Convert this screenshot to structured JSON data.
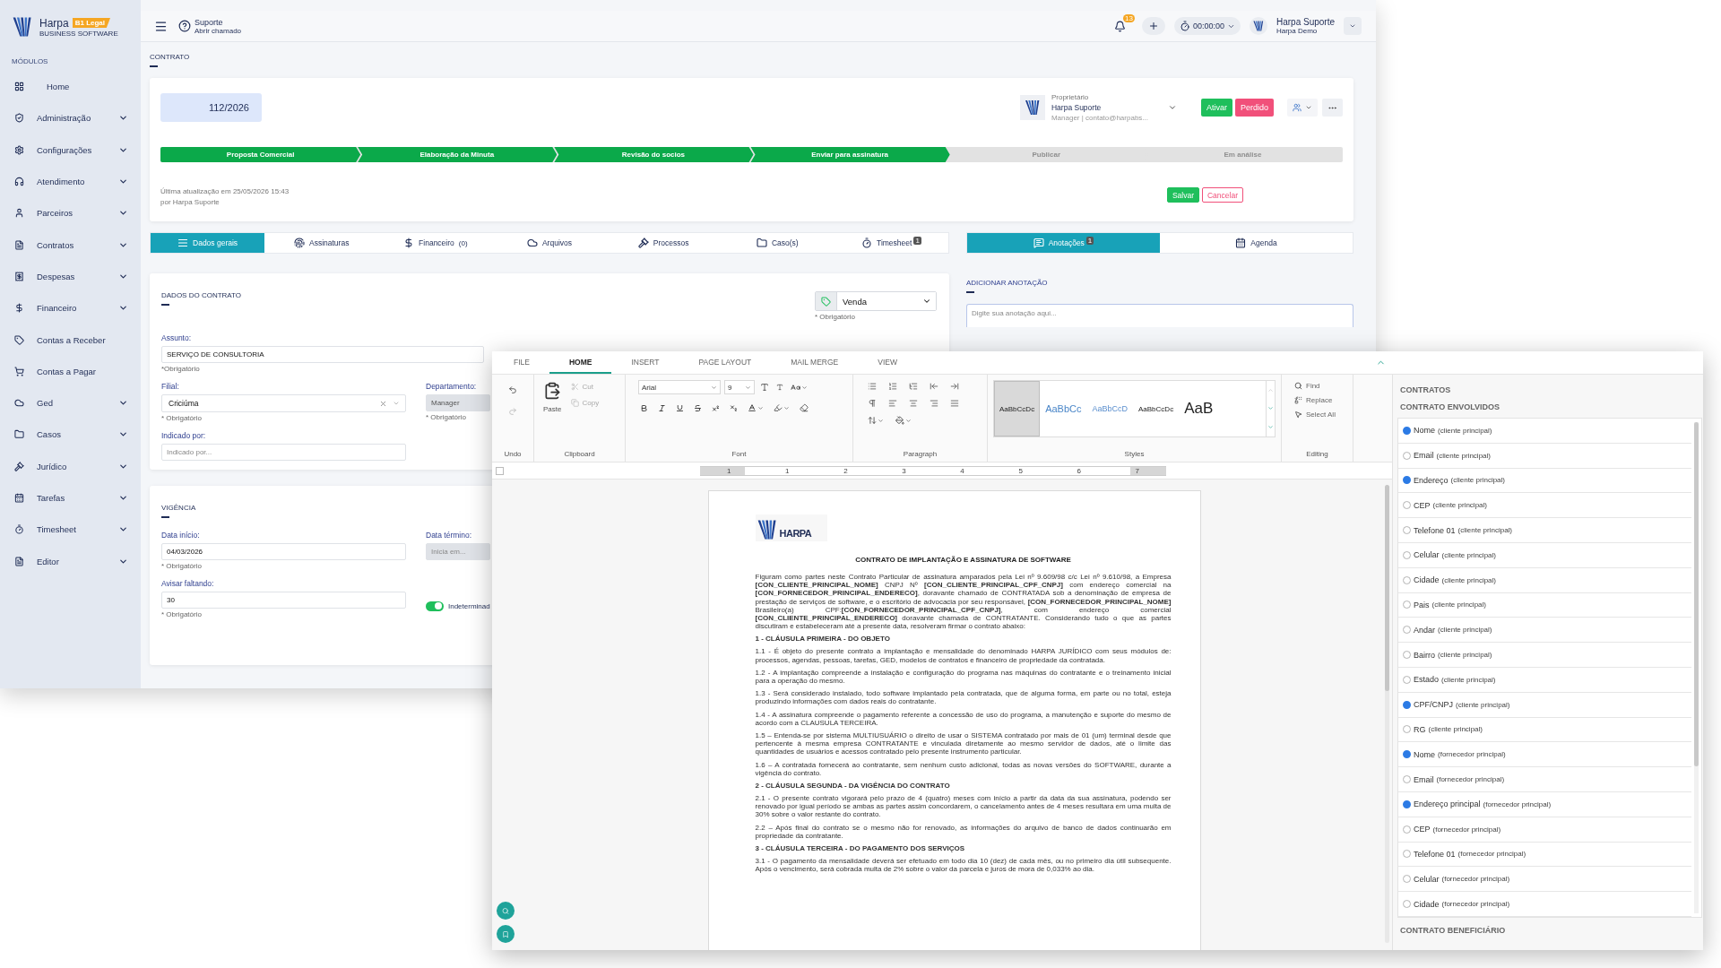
{
  "sidebar": {
    "brand": "Harpa",
    "badge": "B1 Legal",
    "tagline": "BUSINESS SOFTWARE",
    "section": "MÓDULOS",
    "items": [
      {
        "label": "Home",
        "kind": "grid",
        "expandable": false
      },
      {
        "label": "Administração",
        "kind": "shield",
        "expandable": true
      },
      {
        "label": "Configurações",
        "kind": "gear",
        "expandable": true
      },
      {
        "label": "Atendimento",
        "kind": "headset",
        "expandable": true
      },
      {
        "label": "Parceiros",
        "kind": "person",
        "expandable": true
      },
      {
        "label": "Contratos",
        "kind": "document",
        "expandable": true
      },
      {
        "label": "Despesas",
        "kind": "receipt",
        "expandable": true
      },
      {
        "label": "Financeiro",
        "kind": "dollar",
        "expandable": true
      },
      {
        "label": "Contas a Receber",
        "kind": "tag",
        "expandable": false
      },
      {
        "label": "Contas a Pagar",
        "kind": "cart",
        "expandable": false
      },
      {
        "label": "Ged",
        "kind": "cloud",
        "expandable": true
      },
      {
        "label": "Casos",
        "kind": "folder",
        "expandable": true
      },
      {
        "label": "Jurídico",
        "kind": "gavel",
        "expandable": true
      },
      {
        "label": "Tarefas",
        "kind": "calendar",
        "expandable": true
      },
      {
        "label": "Timesheet",
        "kind": "stopwatch",
        "expandable": true
      },
      {
        "label": "Editor",
        "kind": "document",
        "expandable": true
      }
    ]
  },
  "header": {
    "support_title": "Suporte",
    "support_sub": "Abrir chamado",
    "notifications": "13",
    "timer": "00:00:00",
    "user_name": "Harpa Suporte",
    "user_org": "Harpa Demo"
  },
  "page_title": "CONTRATO",
  "contract": {
    "number": "112/2026",
    "owner_label": "Proprietário",
    "owner_name": "Harpa Suporte",
    "owner_detail": "Manager | contato@harpabs...",
    "actions": [
      {
        "label": "Ativar",
        "kind": "success"
      },
      {
        "label": "Perdido",
        "kind": "danger"
      }
    ],
    "stages": [
      {
        "label": "Proposta Comercial",
        "done": true
      },
      {
        "label": "Elaboração da Minuta",
        "done": true
      },
      {
        "label": "Revisão do socios",
        "done": true
      },
      {
        "label": "Enviar para assinatura",
        "done": true
      },
      {
        "label": "Publicar",
        "done": false
      },
      {
        "label": "Em análise",
        "done": false
      }
    ],
    "updated": "Última atualização em 25/05/2026 15:43",
    "updated_by": "por Harpa Suporte",
    "save": "Salvar",
    "cancel": "Cancelar"
  },
  "tabs": [
    {
      "label": "Dados gerais",
      "kind": "lines",
      "selected": true
    },
    {
      "label": "Assinaturas",
      "kind": "fingerprint",
      "selected": false
    },
    {
      "label": "Financeiro",
      "kind": "dollar",
      "selected": false,
      "count": "(0)"
    },
    {
      "label": "Arquivos",
      "kind": "cloud",
      "selected": false
    },
    {
      "label": "Processos",
      "kind": "gavel",
      "selected": false
    },
    {
      "label": "Caso(s)",
      "kind": "folder",
      "selected": false
    },
    {
      "label": "Timesheet",
      "kind": "stopwatch",
      "selected": false,
      "badge": "1"
    }
  ],
  "side_tabs": [
    {
      "label": "Anotações",
      "kind": "chat",
      "selected": true,
      "badge": "1"
    },
    {
      "label": "Agenda",
      "kind": "calendar",
      "selected": false
    }
  ],
  "contract_data": {
    "title": "DADOS DO CONTRATO",
    "type_select": {
      "value": "Venda",
      "hint": "* Obrigatório"
    },
    "rows": [
      [
        {
          "label": "Assunto:",
          "kind": "wide",
          "value": "SERVIÇO DE CONSULTORIA",
          "hint": "*Obrigatório",
          "disabled": false
        }
      ],
      [
        {
          "label": "Filial:",
          "kind": "select",
          "value": "Criciúma",
          "hint": "* Obrigatório",
          "disabled": false
        },
        {
          "label": "Departamento:",
          "kind": "text",
          "value": "Manager",
          "hint": "* Obrigatório",
          "disabled": true
        }
      ],
      [
        {
          "label": "Indicado por:",
          "kind": "text",
          "placeholder": "Indicado por...",
          "disabled": false
        }
      ]
    ]
  },
  "validity": {
    "title": "VIGÊNCIA",
    "rows": [
      [
        {
          "label": "Data início:",
          "kind": "text",
          "value": "04/03/2026",
          "hint": "* Obrigatório",
          "disabled": false
        },
        {
          "label": "Data término:",
          "kind": "text",
          "placeholder": "Inicia em...",
          "disabled": true
        }
      ],
      [
        {
          "label": "Avisar faltando:",
          "kind": "text",
          "value": "30",
          "hint": "* Obrigatório",
          "disabled": false
        },
        {
          "label": "Indeterminad",
          "kind": "toggle",
          "on": true
        }
      ]
    ]
  },
  "annotations": {
    "title": "ADICIONAR ANOTAÇÃO",
    "placeholder": "Digite sua anotação aqui..."
  },
  "editor": {
    "tabs": [
      {
        "label": "FILE",
        "selected": false
      },
      {
        "label": "HOME",
        "selected": true
      },
      {
        "label": "INSERT",
        "selected": false
      },
      {
        "label": "PAGE LAYOUT",
        "selected": false
      },
      {
        "label": "MAIL MERGE",
        "selected": false
      },
      {
        "label": "VIEW",
        "selected": false
      }
    ],
    "ribbon": {
      "undo_label": "Undo",
      "clipboard": {
        "label": "Clipboard",
        "paste": "Paste",
        "tools": [
          {
            "label": "Cut",
            "disabled": true
          },
          {
            "label": "Copy",
            "disabled": true
          }
        ]
      },
      "font": {
        "label": "Font",
        "family": "Arial",
        "size": "9"
      },
      "paragraph": {
        "label": "Paragraph"
      },
      "styles": {
        "label": "Styles",
        "samples": [
          {
            "text": "AaBbCcDc",
            "kind": "normal",
            "selected": true
          },
          {
            "text": "AaBbCc",
            "kind": "heading1",
            "selected": false
          },
          {
            "text": "AaBbCcD",
            "kind": "heading2",
            "selected": false
          },
          {
            "text": "AaBbCcDc",
            "kind": "subtle",
            "selected": false
          },
          {
            "text": "AaB",
            "kind": "title",
            "selected": false
          }
        ]
      },
      "editing": {
        "label": "Editing",
        "actions": [
          {
            "label": "Find",
            "kind": "search"
          },
          {
            "label": "Replace",
            "kind": "replace"
          },
          {
            "label": "Select All",
            "kind": "select"
          }
        ]
      }
    },
    "ruler": [
      "1",
      "1",
      "2",
      "3",
      "4",
      "5",
      "6",
      "7"
    ],
    "document": {
      "logo_text": "HARPA",
      "title": "CONTRATO DE IMPLANTAÇÃO E ASSINATURA DE SOFTWARE",
      "blocks": [
        {
          "kind": "paragraph",
          "text": "Figuram como partes neste Contrato Particular de assinatura amparados pela Lei nº 9.609/98 c/c Lei nº 9.610/98, a Empresa **[CON_CLIENTE_PRINCIPAL_NOME]** CNPJ Nº **[CON_CLIENTE_PRINCIPAL_CPF_CNPJ]** com endereço comercial na **[CON_FORNECEDOR_PRINCIPAL_ENDERECO]**, doravante chamado de CONTRATADA sob a denominação de empresa de prestação de serviços de software, e o escritório de advocacia por seu responsável, **[CON_FORNECEDOR_PRINCIPAL_NOME]** Brasileiro(a) CPF:**[CON_FORNECEDOR_PRINCIPAL_CPF_CNPJ]**, com endereço comercial **[CON_CLIENTE_PRINCIPAL_ENDERECO]** doravante chamada de CONTRATANTE. Considerando tudo o que as partes discutiram e estabeleceram até a presente data, resolveram firmar o contrato abaixo:"
        },
        {
          "kind": "heading",
          "text": "1 - CLÁUSULA PRIMEIRA - DO OBJETO"
        },
        {
          "kind": "paragraph",
          "text": "1.1 - É objeto do presente contrato a implantação e mensalidade do denominado HARPA JURÍDICO com seus módulos de: processos, agendas, pessoas, tarefas, GED, modelos de contratos e financeiro de propriedade da contratada."
        },
        {
          "kind": "paragraph",
          "text": "1.2 - A implantação compreende a instalação e configuração do programa nas máquinas do contratante e o treinamento inicial para a operação do mesmo."
        },
        {
          "kind": "paragraph",
          "text": "1.3 - Será considerado instalado, todo software implantado pela contratada, que de alguma forma, em parte ou no total, esteja produzindo informações com dados reais do contratante."
        },
        {
          "kind": "paragraph",
          "text": "1.4 - A assinatura compreende o pagamento referente a concessão de uso do programa, a manutenção e suporte do mesmo de acordo com a CLAUSULA TERCEIRA."
        },
        {
          "kind": "paragraph",
          "text": "1.5 – Entenda-se por sistema MULTIUSUÁRIO o direito de usar o SISTEMA contratado por mais de 01 (um) terminal desde que pertencente à mesma empresa CONTRATANTE e vinculada diretamente ao mesmo servidor de dados, até o limite das quantidades de usuários e acessos contratado pelo presente instrumento particular."
        },
        {
          "kind": "paragraph",
          "text": "1.6 – A contratada fornecerá ao contratante, sem nenhum custo adicional, todas as novas versões do SOFTWARE, durante a vigência do contrato."
        },
        {
          "kind": "heading",
          "text": "2 - CLÁUSULA SEGUNDA - DA VIGÊNCIA DO CONTRATO"
        },
        {
          "kind": "paragraph",
          "text": "2.1 - O presente contrato vigorará pelo prazo de 4 (quatro) meses com início a partir da data da sua assinatura, podendo ser renovado por igual período se ambas as partes assim concordarem, o cancelamento antes de 4 meses resultara em uma multa de 30% sobre o valor restante do contrato."
        },
        {
          "kind": "paragraph",
          "text": "2.2 – Após final do contrato se o mesmo não for renovado, as informações do arquivo de banco de dados continuarão em propriedade da contratante."
        },
        {
          "kind": "heading",
          "text": "3 - CLÁUSULA TERCEIRA - DO PAGAMENTO DOS SERVIÇOS"
        },
        {
          "kind": "paragraph",
          "text": "3.1 - O pagamento da mensalidade deverá ser efetuado em todo dia 10 (dez) de cada mês, ou no primeiro dia útil subsequente. Após o vencimento, será cobrada multa de 2% sobre o valor da parcela e juros de mora de 0,033% ao dia."
        }
      ]
    },
    "fields_panel": {
      "title": "CONTRATOS",
      "sections": [
        {
          "title": "CONTRATO ENVOLVIDOS",
          "items": [
            {
              "label": "Nome",
              "note": "(cliente principal)",
              "checked": true
            },
            {
              "label": "Email",
              "note": "(cliente principal)",
              "checked": false
            },
            {
              "label": "Endereço",
              "note": "(cliente principal)",
              "checked": true
            },
            {
              "label": "CEP",
              "note": "(cliente principal)",
              "checked": false
            },
            {
              "label": "Telefone 01",
              "note": "(cliente principal)",
              "checked": false
            },
            {
              "label": "Celular",
              "note": "(cliente principal)",
              "checked": false
            },
            {
              "label": "Cidade",
              "note": "(cliente principal)",
              "checked": false
            },
            {
              "label": "Pais",
              "note": "(cliente principal)",
              "checked": false
            },
            {
              "label": "Andar",
              "note": "(cliente principal)",
              "checked": false
            },
            {
              "label": "Bairro",
              "note": "(cliente principal)",
              "checked": false
            },
            {
              "label": "Estado",
              "note": "(cliente principal)",
              "checked": false
            },
            {
              "label": "CPF/CNPJ",
              "note": "(cliente principal)",
              "checked": true
            },
            {
              "label": "RG",
              "note": "(cliente principal)",
              "checked": false
            },
            {
              "label": "Nome",
              "note": "(fornecedor principal)",
              "checked": true
            },
            {
              "label": "Email",
              "note": "(fornecedor principal)",
              "checked": false
            },
            {
              "label": "Endereço principal",
              "note": "(fornecedor principal)",
              "checked": true
            },
            {
              "label": "CEP",
              "note": "(fornecedor principal)",
              "checked": false
            },
            {
              "label": "Telefone 01",
              "note": "(fornecedor principal)",
              "checked": false
            },
            {
              "label": "Celular",
              "note": "(fornecedor principal)",
              "checked": false
            },
            {
              "label": "Cidade",
              "note": "(fornecedor principal)",
              "checked": false
            }
          ]
        },
        {
          "title": "CONTRATO BENEFICIÁRIO"
        }
      ]
    }
  }
}
